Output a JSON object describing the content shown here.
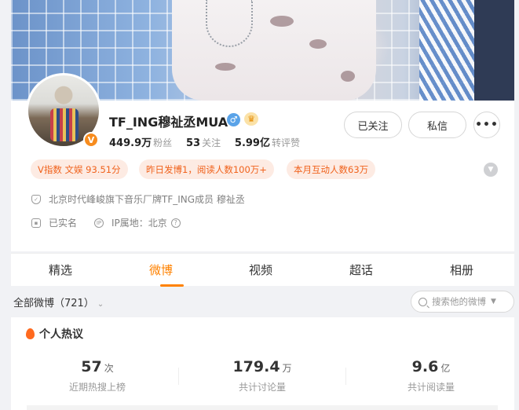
{
  "profile": {
    "name": "TF_ING穆祉丞MUA",
    "verified_badge": "V",
    "gender_icon": "male-icon",
    "stats": {
      "followers_value": "449.9万",
      "followers_label": "粉丝",
      "following_value": "53",
      "following_label": "关注",
      "likes_value": "5.99亿",
      "likes_label": "转评赞"
    },
    "buttons": {
      "follow": "已关注",
      "message": "私信",
      "more": "•••"
    },
    "tags": [
      "V指数 文娱 93.51分",
      "昨日发博1，阅读人数100万+",
      "本月互动人数63万"
    ],
    "bio": "北京时代峰峻旗下音乐厂牌TF_ING成员 穆祉丞",
    "real_name": "已实名",
    "ip": "IP属地：北京",
    "colors": {
      "accent": "#ff8200",
      "tag_bg": "#fdebe3",
      "tag_text": "#f0621c"
    }
  },
  "tabs": [
    {
      "label": "精选",
      "active": false
    },
    {
      "label": "微博",
      "active": true
    },
    {
      "label": "视频",
      "active": false
    },
    {
      "label": "超话",
      "active": false
    },
    {
      "label": "相册",
      "active": false
    }
  ],
  "filter": {
    "label": "全部微博（721）"
  },
  "search": {
    "placeholder": "搜索他的微博"
  },
  "hot": {
    "title": "个人热议",
    "metrics": [
      {
        "value": "57",
        "unit": "次",
        "label": "近期热搜上榜"
      },
      {
        "value": "179.4",
        "unit": "万",
        "label": "共计讨论量"
      },
      {
        "value": "9.6",
        "unit": "亿",
        "label": "共计阅读量"
      }
    ]
  }
}
